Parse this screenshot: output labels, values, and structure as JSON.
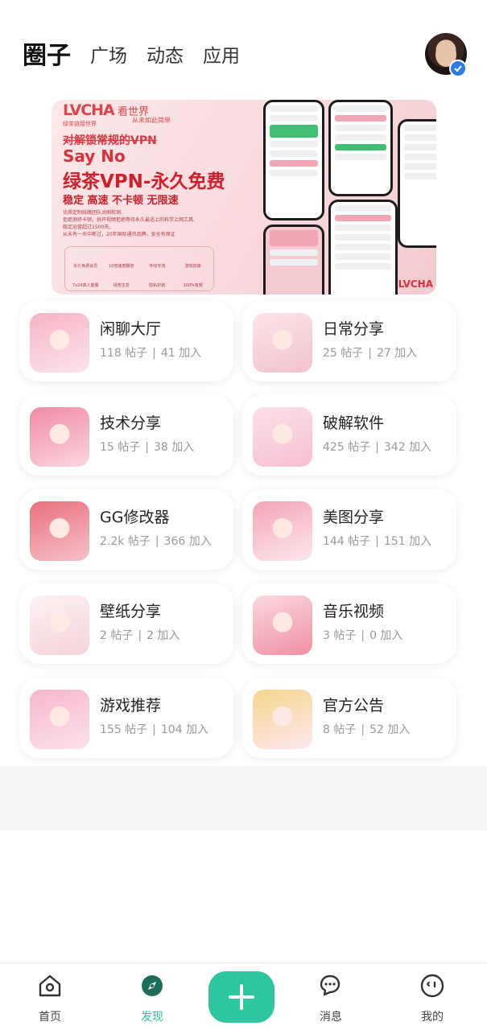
{
  "header": {
    "tabs": [
      {
        "label": "圈子",
        "active": true
      },
      {
        "label": "广场",
        "active": false
      },
      {
        "label": "动态",
        "active": false
      },
      {
        "label": "应用",
        "active": false
      }
    ]
  },
  "banner": {
    "logo": "LVCHA",
    "logo_sub": "绿茶链接世界",
    "slogan": "看世界",
    "slogan_sub": "从未如此简单",
    "line1": "对解锁常规的VPN",
    "line2": "Say No",
    "line3": "绿茶VPN-永久免费",
    "line4": "稳定 高速 不卡顿 无限速",
    "small_lines": [
      "优质定制线路团队对刷检测,",
      "拒绝测挤卡顿，扮开视频拒绝等待永久最适上的科学上网工具,",
      "稳定运营超过1500天。",
      "从未有一天中断过，20年国际通讯品牌，安全有保证"
    ],
    "features": [
      "永久免费会员",
      "10倍速度翻倍",
      "专线专流",
      "游戏加速",
      "7x24真人客服",
      "绿茶生态",
      "隐私护航",
      "100%有效"
    ],
    "corner_logo": "LVCHA"
  },
  "circles": [
    {
      "title": "闲聊大厅",
      "posts": "118 帖子",
      "joins": "41 加入"
    },
    {
      "title": "日常分享",
      "posts": "25 帖子",
      "joins": "27 加入"
    },
    {
      "title": "技术分享",
      "posts": "15 帖子",
      "joins": "38 加入"
    },
    {
      "title": "破解软件",
      "posts": "425 帖子",
      "joins": "342 加入"
    },
    {
      "title": "GG修改器",
      "posts": "2.2k 帖子",
      "joins": "366 加入"
    },
    {
      "title": "美图分享",
      "posts": "144 帖子",
      "joins": "151 加入"
    },
    {
      "title": "壁纸分享",
      "posts": "2 帖子",
      "joins": "2 加入"
    },
    {
      "title": "音乐视频",
      "posts": "3 帖子",
      "joins": "0 加入"
    },
    {
      "title": "游戏推荐",
      "posts": "155 帖子",
      "joins": "104 加入"
    },
    {
      "title": "官方公告",
      "posts": "8 帖子",
      "joins": "52 加入"
    }
  ],
  "separator": "|",
  "bottom_nav": {
    "home": "首页",
    "discover": "发现",
    "messages": "消息",
    "mine": "我的"
  },
  "colors": {
    "accent": "#2ec6a0",
    "active_label": "#2fbf9b",
    "banner_red": "#cf1f2c"
  }
}
